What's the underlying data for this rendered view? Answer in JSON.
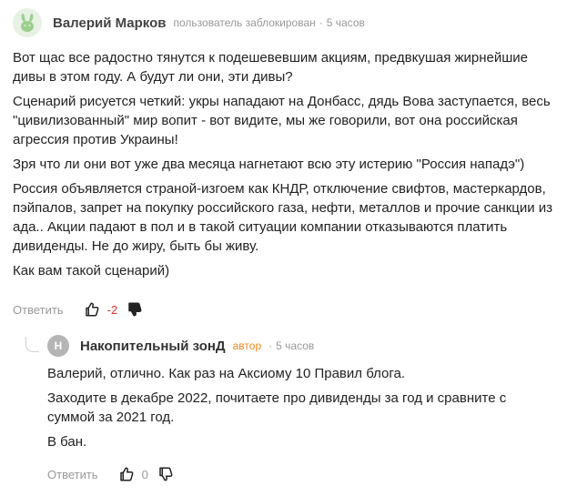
{
  "comment": {
    "author": "Валерий Марков",
    "status": "пользователь заблокирован",
    "separator": "·",
    "time": "5 часов",
    "paragraphs": [
      "Вот щас все радостно тянутся к подешевевшим акциям, предвкушая жирнейшие дивы в этом году. А будут ли они, эти дивы?",
      "Сценарий рисуется четкий: укры нападают на Донбасс, дядь Вова заступается, весь \"цивилизованный\" мир вопит - вот видите, мы же говорили, вот она российская агрессия против Украины!",
      "Зря что ли они вот уже два месяца нагнетают всю эту истерию \"Россия нападэ\")",
      "Россия объявляется страной-изгоем как КНДР, отключение свифтов, мастеркардов, пэйпалов, запрет на покупку российского газа, нефти, металлов и прочие санкции из ада.. Акции падают в пол и в такой ситуации компании отказываются платить дивиденды. Не до жиру, быть бы живу.",
      "Как вам такой сценарий)"
    ],
    "reply_label": "Ответить",
    "score": "-2"
  },
  "reply": {
    "avatar_letter": "Н",
    "author": "Накопительный зонД",
    "badge": "автор",
    "separator": "·",
    "time": "5 часов",
    "paragraphs": [
      "Валерий, отлично. Как раз на Аксиому 10 Правил блога.",
      "Заходите в декабре 2022, почитаете про дивиденды за год и сравните с суммой за 2021 год.",
      "В бан."
    ],
    "reply_label": "Ответить",
    "score": "0"
  },
  "icons": {
    "avatar": "bunny-avatar-icon",
    "like": "thumbs-up-icon",
    "dislike": "thumbs-down-icon"
  },
  "colors": {
    "negative_score": "#e0332c",
    "author_badge": "#f08a1c",
    "meta": "#999999"
  }
}
